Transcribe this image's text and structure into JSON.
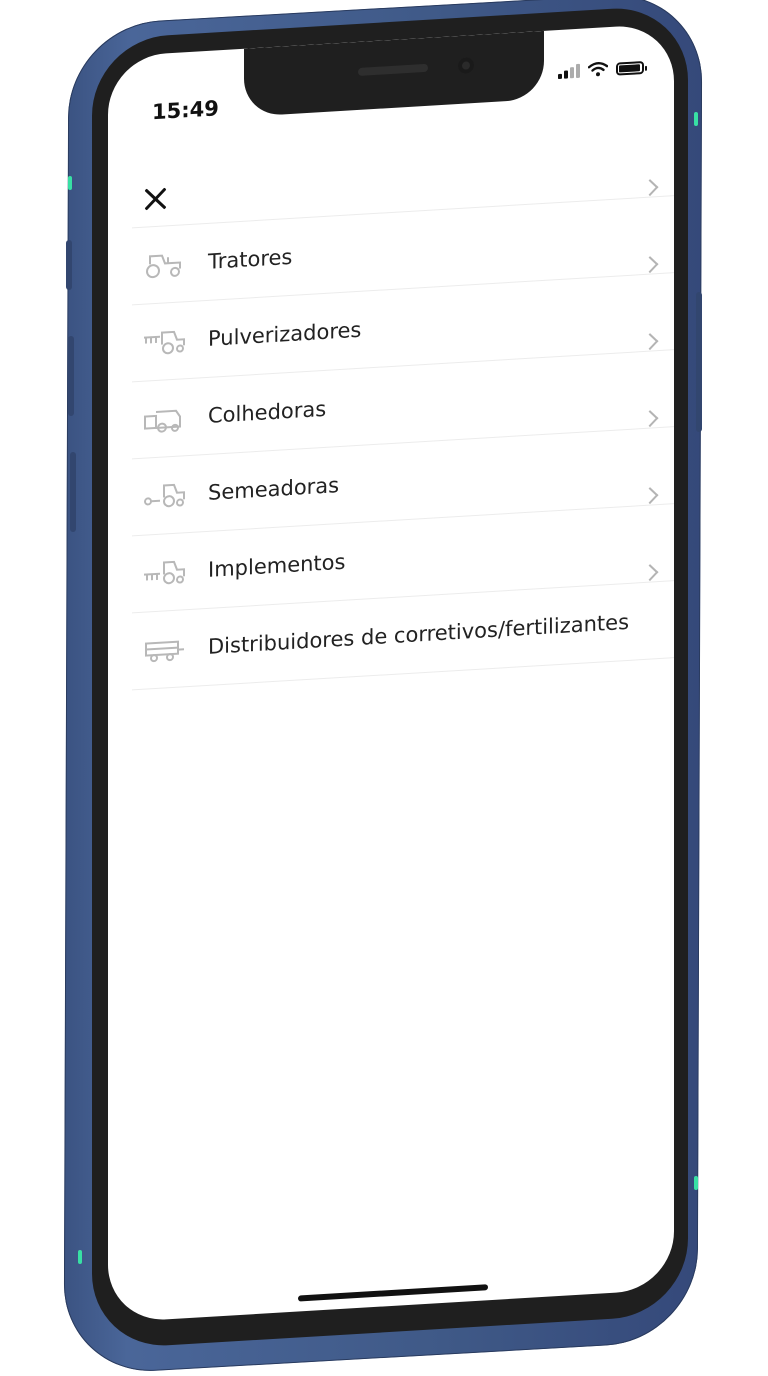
{
  "status_bar": {
    "time": "15:49",
    "icons": [
      "signal-icon",
      "wifi-icon",
      "battery-icon"
    ]
  },
  "nav": {
    "close_icon": "close-icon"
  },
  "menu": {
    "items": [
      {
        "label": "Tratores",
        "icon": "tractor-icon"
      },
      {
        "label": "Pulverizadores",
        "icon": "sprayer-icon"
      },
      {
        "label": "Colhedoras",
        "icon": "harvester-icon"
      },
      {
        "label": "Semeadoras",
        "icon": "seeder-icon"
      },
      {
        "label": "Implementos",
        "icon": "implement-icon"
      },
      {
        "label": "Distribuidores de corretivos/fertilizantes",
        "icon": "spreader-icon"
      }
    ]
  },
  "colors": {
    "frame": "#3f5987",
    "accent": "#38e0a4",
    "icon_gray": "#b8b8b8",
    "text": "#222222"
  }
}
